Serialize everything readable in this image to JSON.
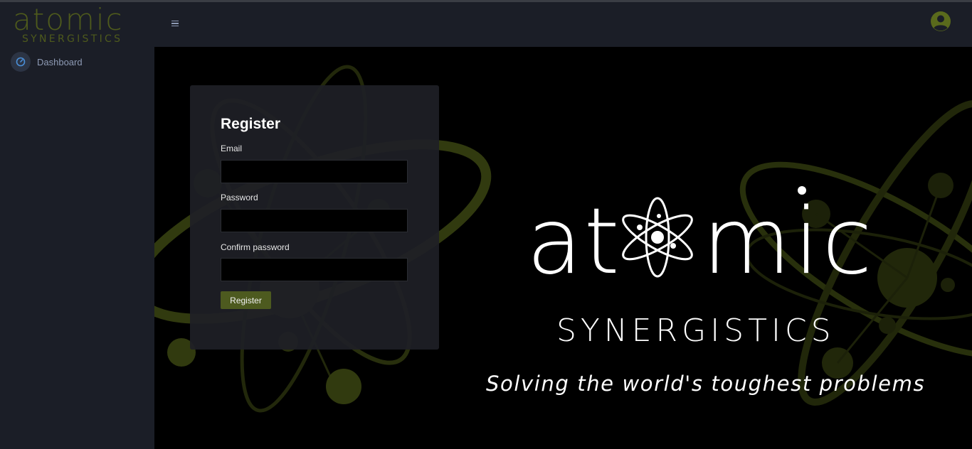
{
  "brand": {
    "wordmark": "atomic",
    "subtitle": "SYNERGISTICS"
  },
  "sidebar": {
    "items": [
      {
        "label": "Dashboard",
        "icon": "speedometer-icon"
      }
    ]
  },
  "topbar": {
    "menu_icon": "hamburger-icon",
    "user_icon": "user-circle-icon"
  },
  "register": {
    "title": "Register",
    "email_label": "Email",
    "email_value": "",
    "password_label": "Password",
    "password_value": "",
    "confirm_label": "Confirm password",
    "confirm_value": "",
    "submit_label": "Register"
  },
  "hero": {
    "wordmark": "atomic",
    "subtitle": "SYNERGISTICS",
    "tagline": "Solving the world's toughest problems"
  },
  "colors": {
    "accent": "#4d5a1f",
    "sidebar_bg": "#1b1e27",
    "hero_text": "#ffffff",
    "orbit_green": "#5a6a1c"
  }
}
